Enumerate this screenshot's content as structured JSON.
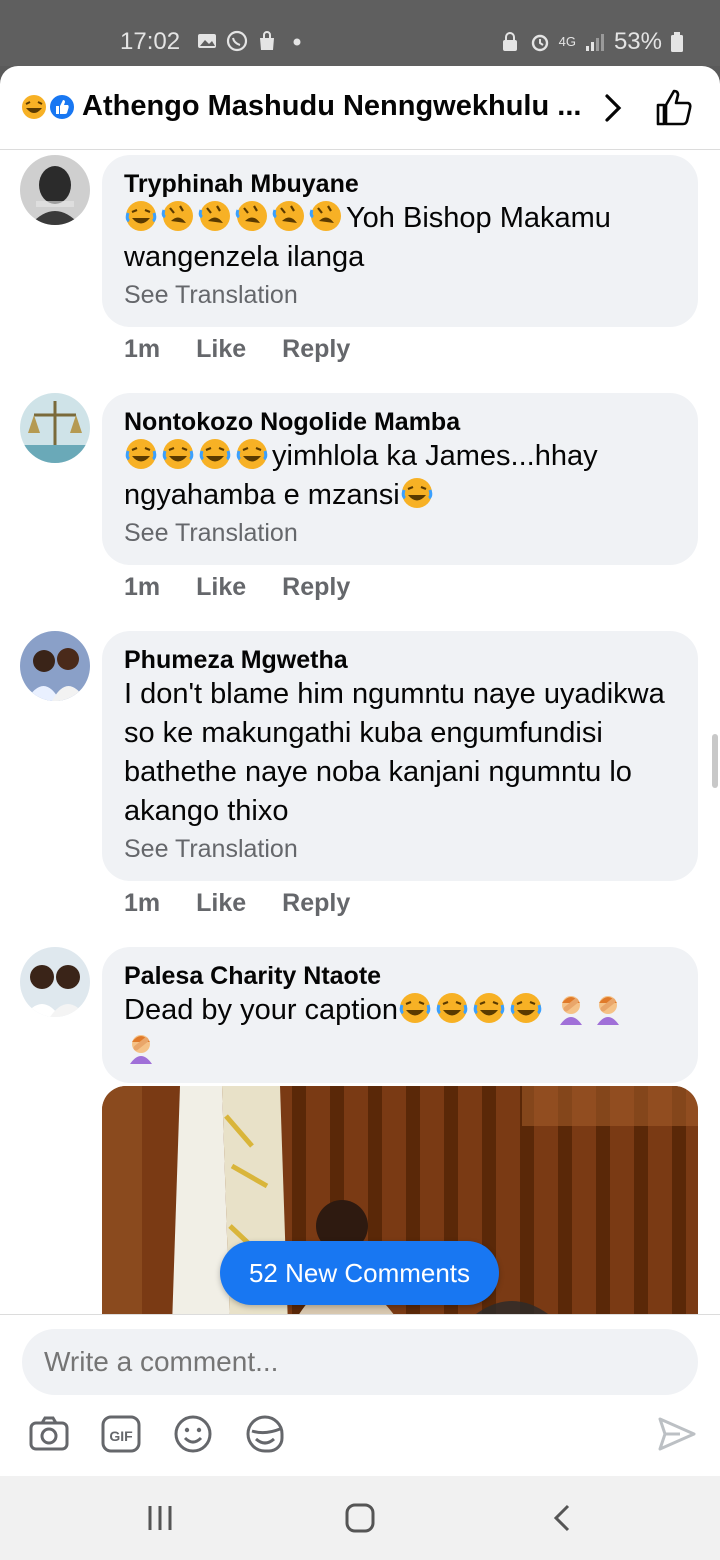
{
  "status_bar": {
    "time": "17:02",
    "battery": "53%",
    "network": "4G"
  },
  "header": {
    "title": "Athengo Mashudu Nenngwekhulu ..."
  },
  "comments": [
    {
      "author": "Tryphinah Mbuyane",
      "text": "Yoh Bishop Makamu wangenzela ilanga",
      "see_translation": "See Translation",
      "time": "1m",
      "like": "Like",
      "reply": "Reply"
    },
    {
      "author": "Nontokozo Nogolide Mamba",
      "text1": "yimhlola ka James...hhay ngyahamba e mzansi",
      "see_translation": "See Translation",
      "time": "1m",
      "like": "Like",
      "reply": "Reply"
    },
    {
      "author": "Phumeza Mgwetha",
      "text": "I don't blame  him  ngumntu naye uyadikwa  so ke makungathi  kuba engumfundisi  bathethe naye noba kanjani ngumntu lo akango thixo",
      "see_translation": "See Translation",
      "time": "1m",
      "like": "Like",
      "reply": "Reply"
    },
    {
      "author": "Palesa Charity Ntaote",
      "text": "Dead by your caption"
    }
  ],
  "new_comments_label": "52 New Comments",
  "composer": {
    "placeholder": "Write a comment..."
  },
  "icons": [
    "camera-icon",
    "gif-icon",
    "emoji-icon",
    "sticker-icon",
    "send-icon",
    "like-icon",
    "chevron-right-icon"
  ],
  "colors": {
    "accent": "#1877f2",
    "bubble": "#f0f2f5",
    "secondary_text": "#65676b"
  }
}
